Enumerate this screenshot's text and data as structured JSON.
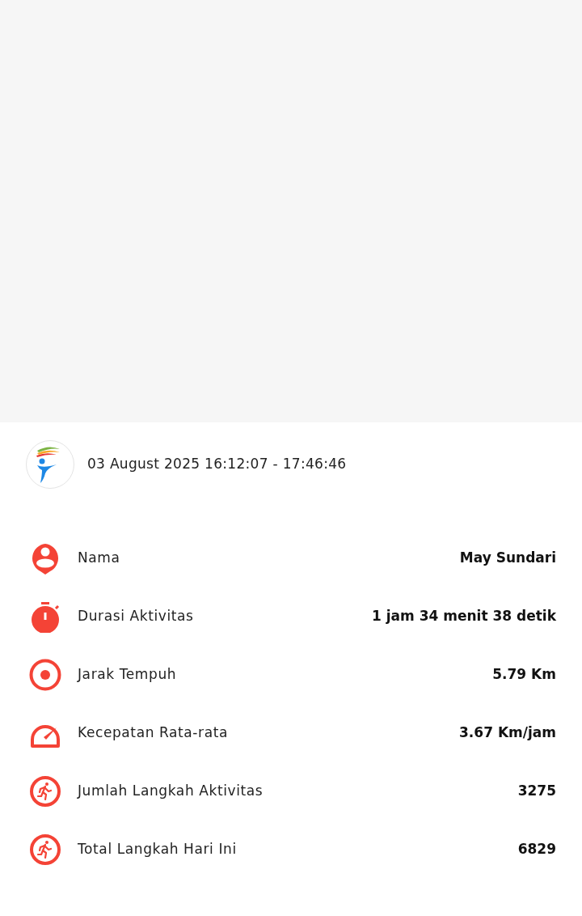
{
  "session": {
    "datetime": "03 August 2025 16:12:07 - 17:46:46"
  },
  "stats": [
    {
      "kind": "person",
      "label": "Nama",
      "value": "May Sundari"
    },
    {
      "kind": "stopwatch",
      "label": "Durasi Aktivitas",
      "value": "1 jam 34 menit 38 detik"
    },
    {
      "kind": "target",
      "label": "Jarak Tempuh",
      "value": "5.79 Km"
    },
    {
      "kind": "speed",
      "label": "Kecepatan Rata-rata",
      "value": "3.67 Km/jam"
    },
    {
      "kind": "runner",
      "label": "Jumlah Langkah Aktivitas",
      "value": "3275"
    },
    {
      "kind": "runner",
      "label": "Total Langkah Hari Ini",
      "value": "6829"
    }
  ]
}
